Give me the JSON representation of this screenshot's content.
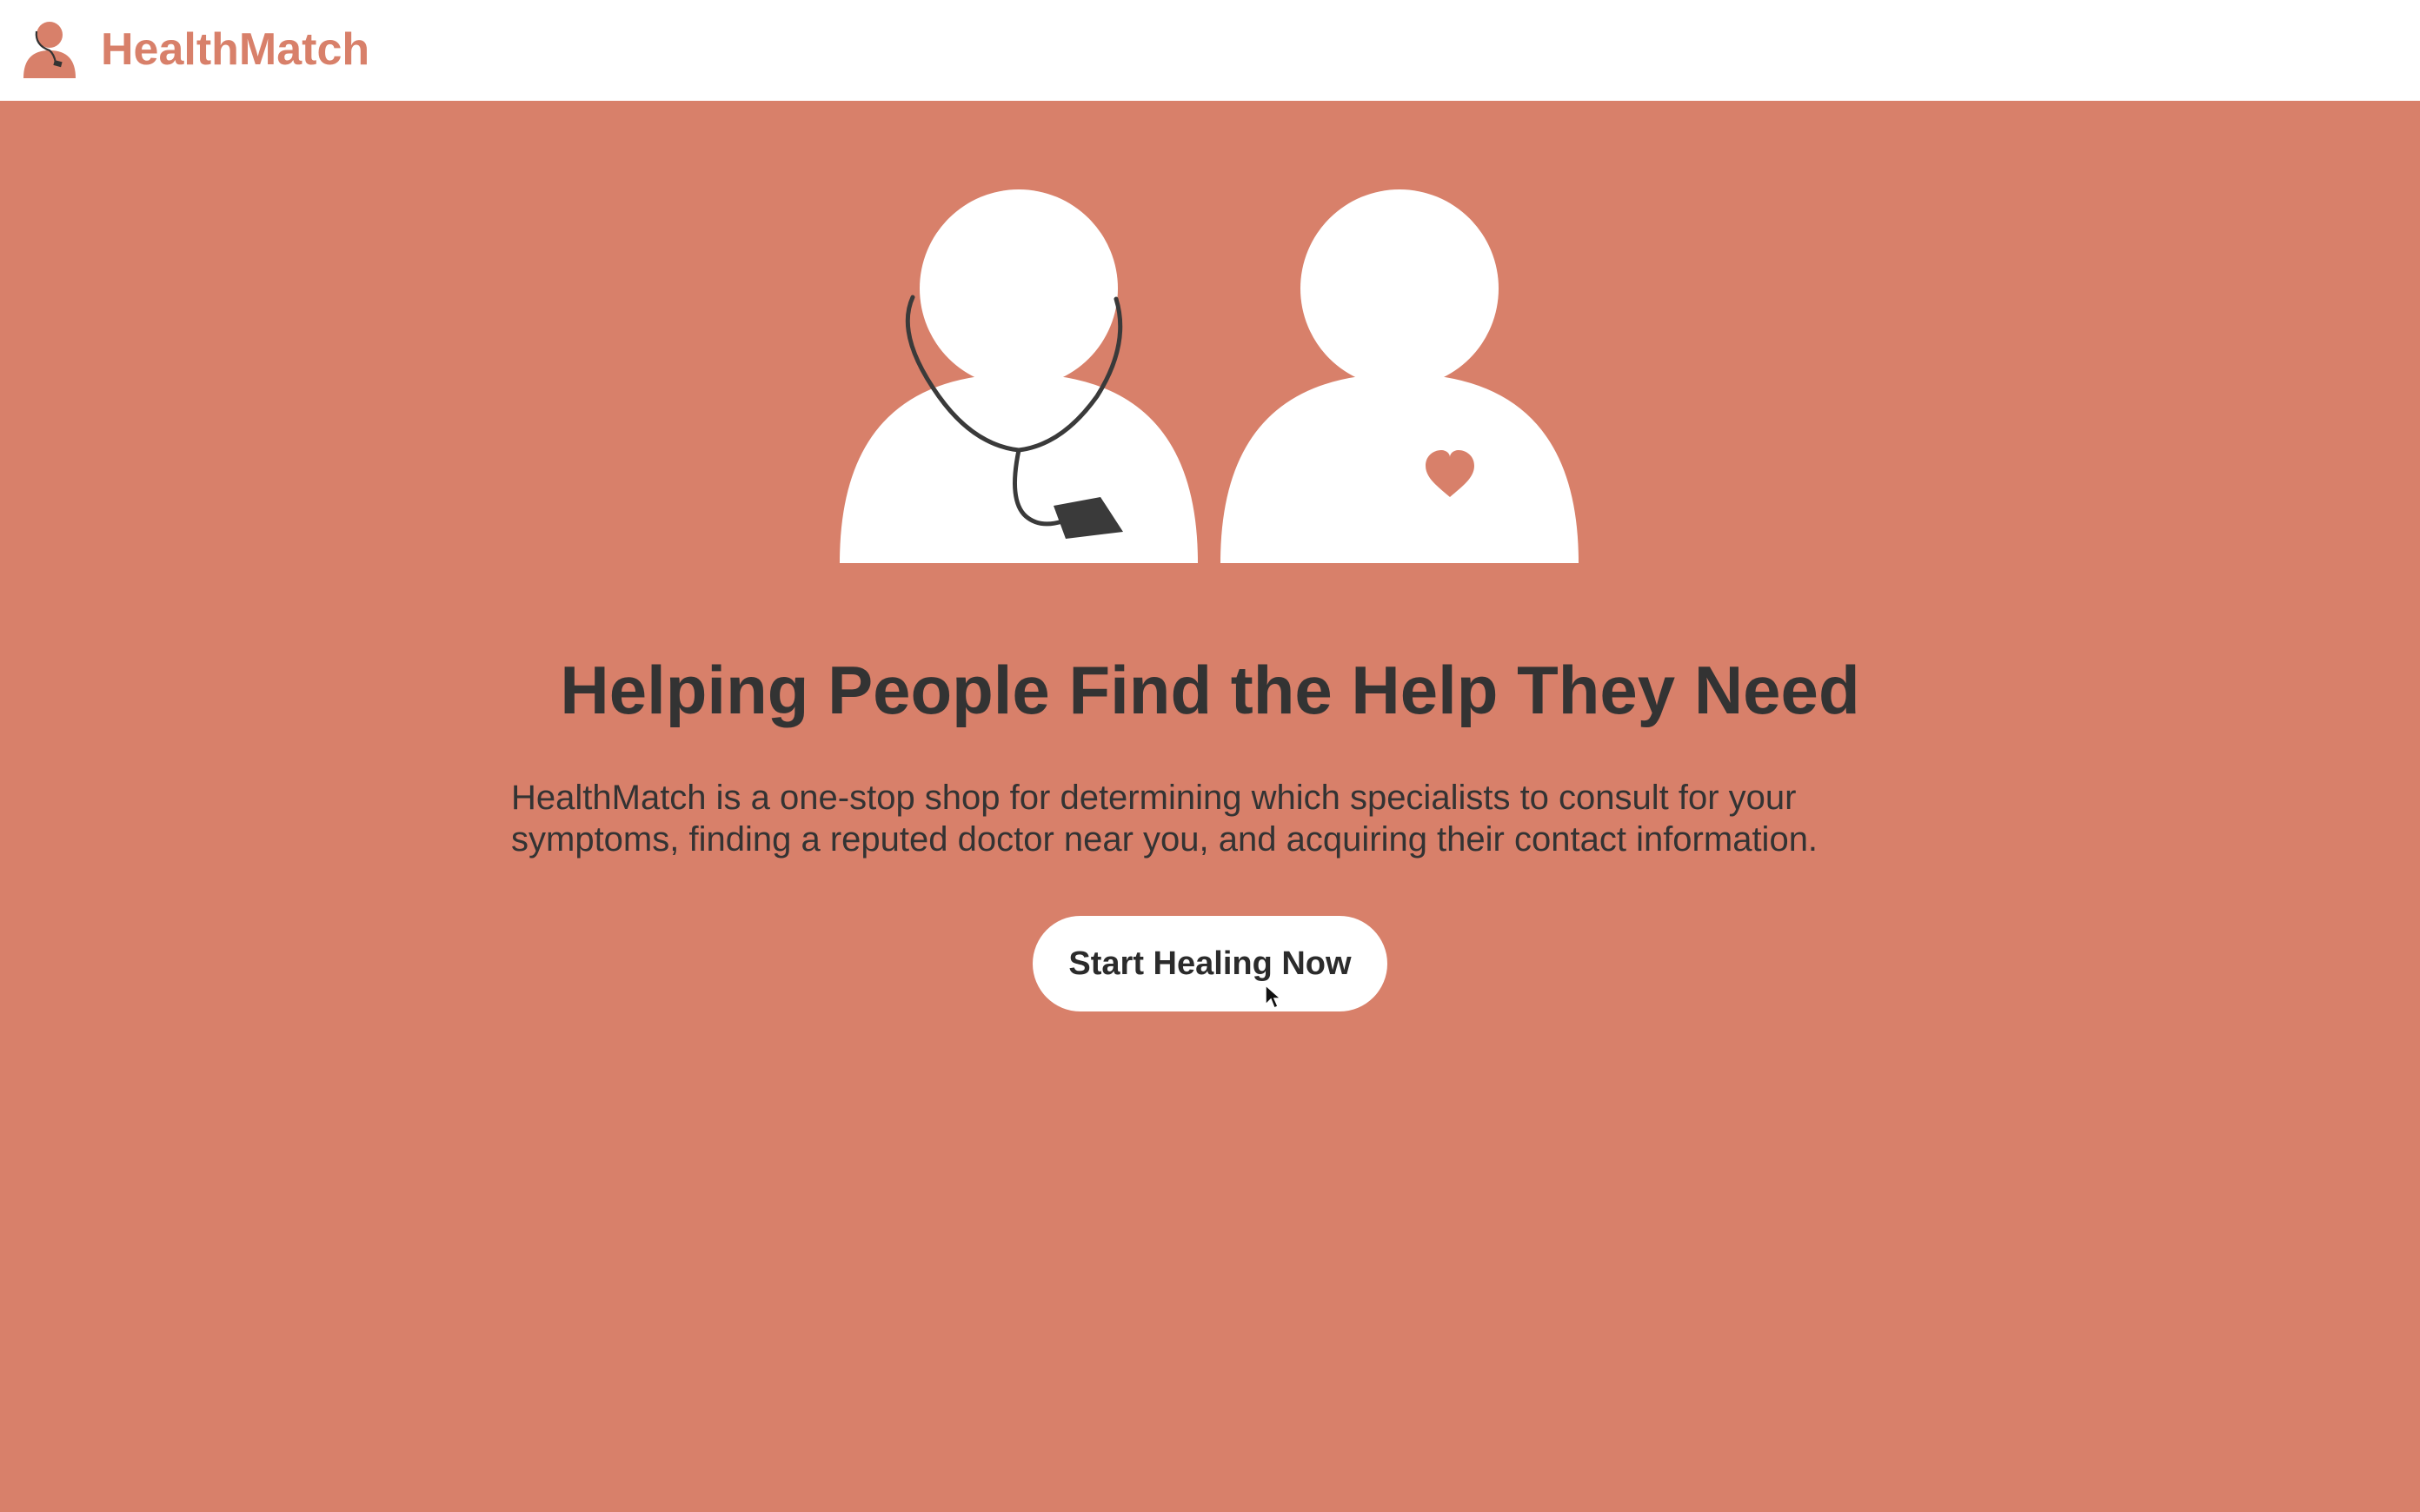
{
  "navbar": {
    "brand": "HealthMatch",
    "logo_icon": "doctor-with-stethoscope-icon"
  },
  "hero": {
    "illustration": {
      "figures": [
        "doctor-with-stethoscope-icon",
        "patient-with-heart-icon"
      ]
    },
    "headline": "Helping People Find the Help They Need",
    "description": "HealthMatch is a one-stop shop for determining which specialists to consult for your symptoms, finding a reputed doctor near you, and acquiring their contact information.",
    "cta_label": "Start Healing Now"
  },
  "colors": {
    "accent": "#d8806a",
    "background_nav": "#ffffff",
    "text_dark": "#333333",
    "button_bg": "#ffffff"
  }
}
